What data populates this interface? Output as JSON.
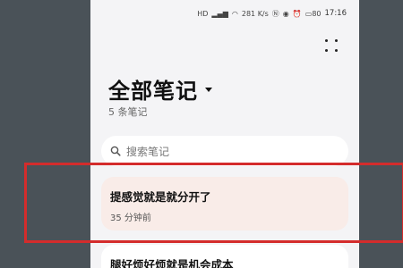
{
  "status_bar": {
    "icons": [
      "hd-icon",
      "signal-icon",
      "wifi-icon",
      "data-speed",
      "nfc-icon",
      "eye-icon",
      "alarm-icon",
      "battery-icon"
    ],
    "data_speed": "281 K/s",
    "battery": "80",
    "time": "17:16"
  },
  "header": {
    "title": "全部笔记",
    "count": "5 条笔记"
  },
  "search": {
    "placeholder": "搜索笔记"
  },
  "notes": [
    {
      "title": "提感觉就是就分开了",
      "time": "35 分钟前"
    },
    {
      "title": "腿好烦好烦就是机会成本",
      "time": ""
    }
  ],
  "colors": {
    "highlight_frame": "#d42c2c",
    "selected_card": "#f9ece8",
    "background": "#4a5258"
  }
}
